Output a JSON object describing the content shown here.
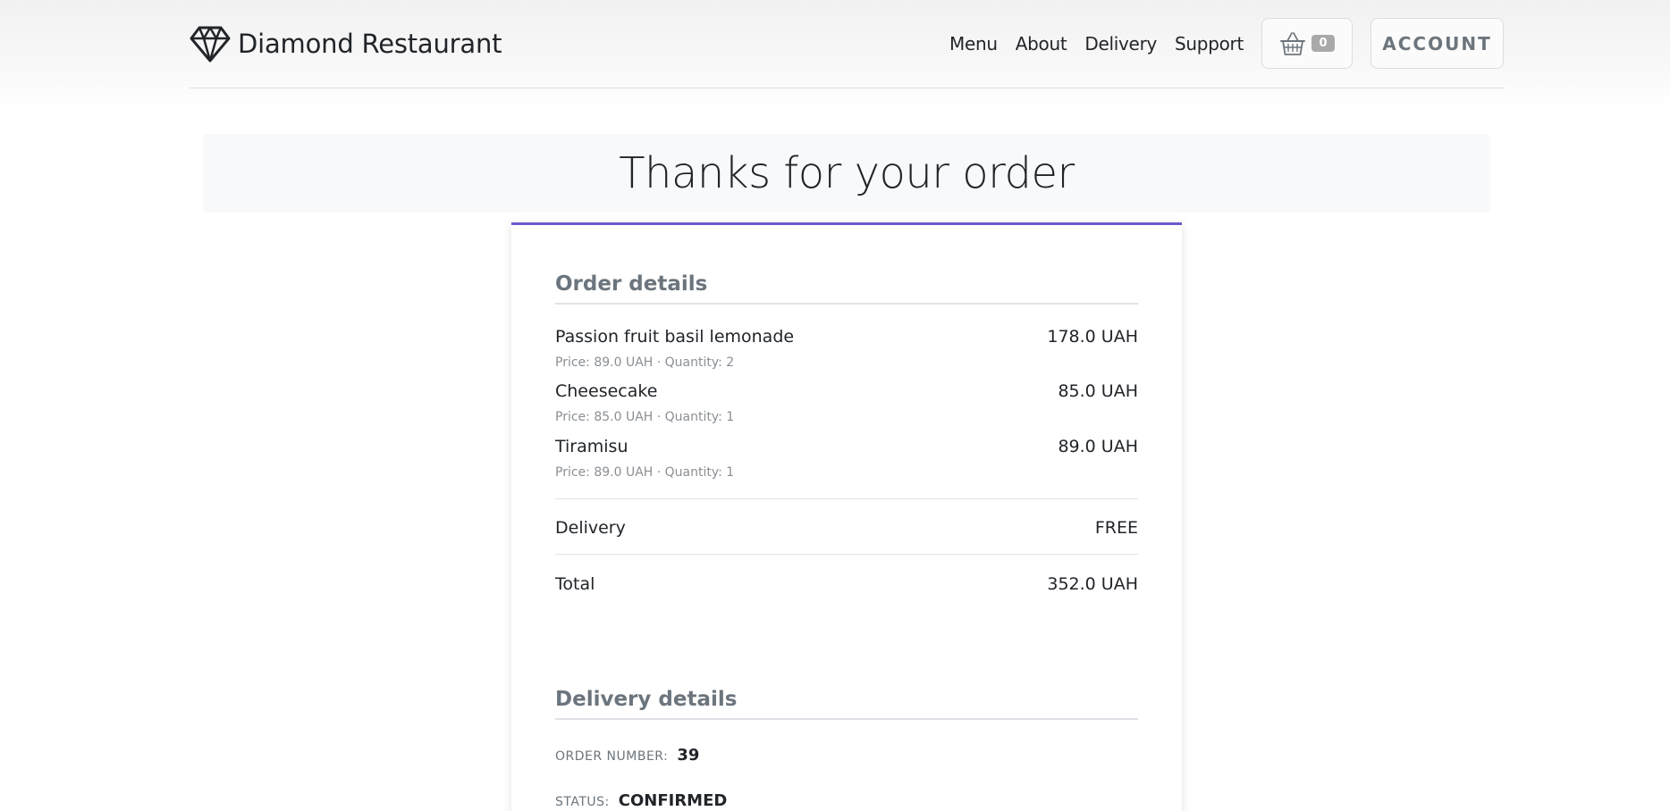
{
  "header": {
    "brand_name": "Diamond Restaurant",
    "brand_icon": "diamond-icon",
    "nav": [
      "Menu",
      "About",
      "Delivery",
      "Support"
    ],
    "cart_icon": "basket-icon",
    "cart_count": "0",
    "account_label": "ACCOUNT"
  },
  "page": {
    "title": "Thanks for your order"
  },
  "order": {
    "section_title": "Order details",
    "items": [
      {
        "name": "Passion fruit basil lemonade",
        "total": "178.0 UAH",
        "meta": "Price: 89.0 UAH · Quantity: 2"
      },
      {
        "name": "Cheesecake",
        "total": "85.0 UAH",
        "meta": "Price: 85.0 UAH · Quantity: 1"
      },
      {
        "name": "Tiramisu",
        "total": "89.0 UAH",
        "meta": "Price: 89.0 UAH · Quantity: 1"
      }
    ],
    "delivery_label": "Delivery",
    "delivery_value": "FREE",
    "total_label": "Total",
    "total_value": "352.0 UAH"
  },
  "delivery_details": {
    "section_title": "Delivery details",
    "order_number_label": "ORDER NUMBER:",
    "order_number_value": "39",
    "status_label": "STATUS:",
    "status_value": "CONFIRMED"
  },
  "colors": {
    "accent": "#6a5acd",
    "section_title": "#6c757d",
    "jumbotron_bg": "#f8f9fa"
  }
}
